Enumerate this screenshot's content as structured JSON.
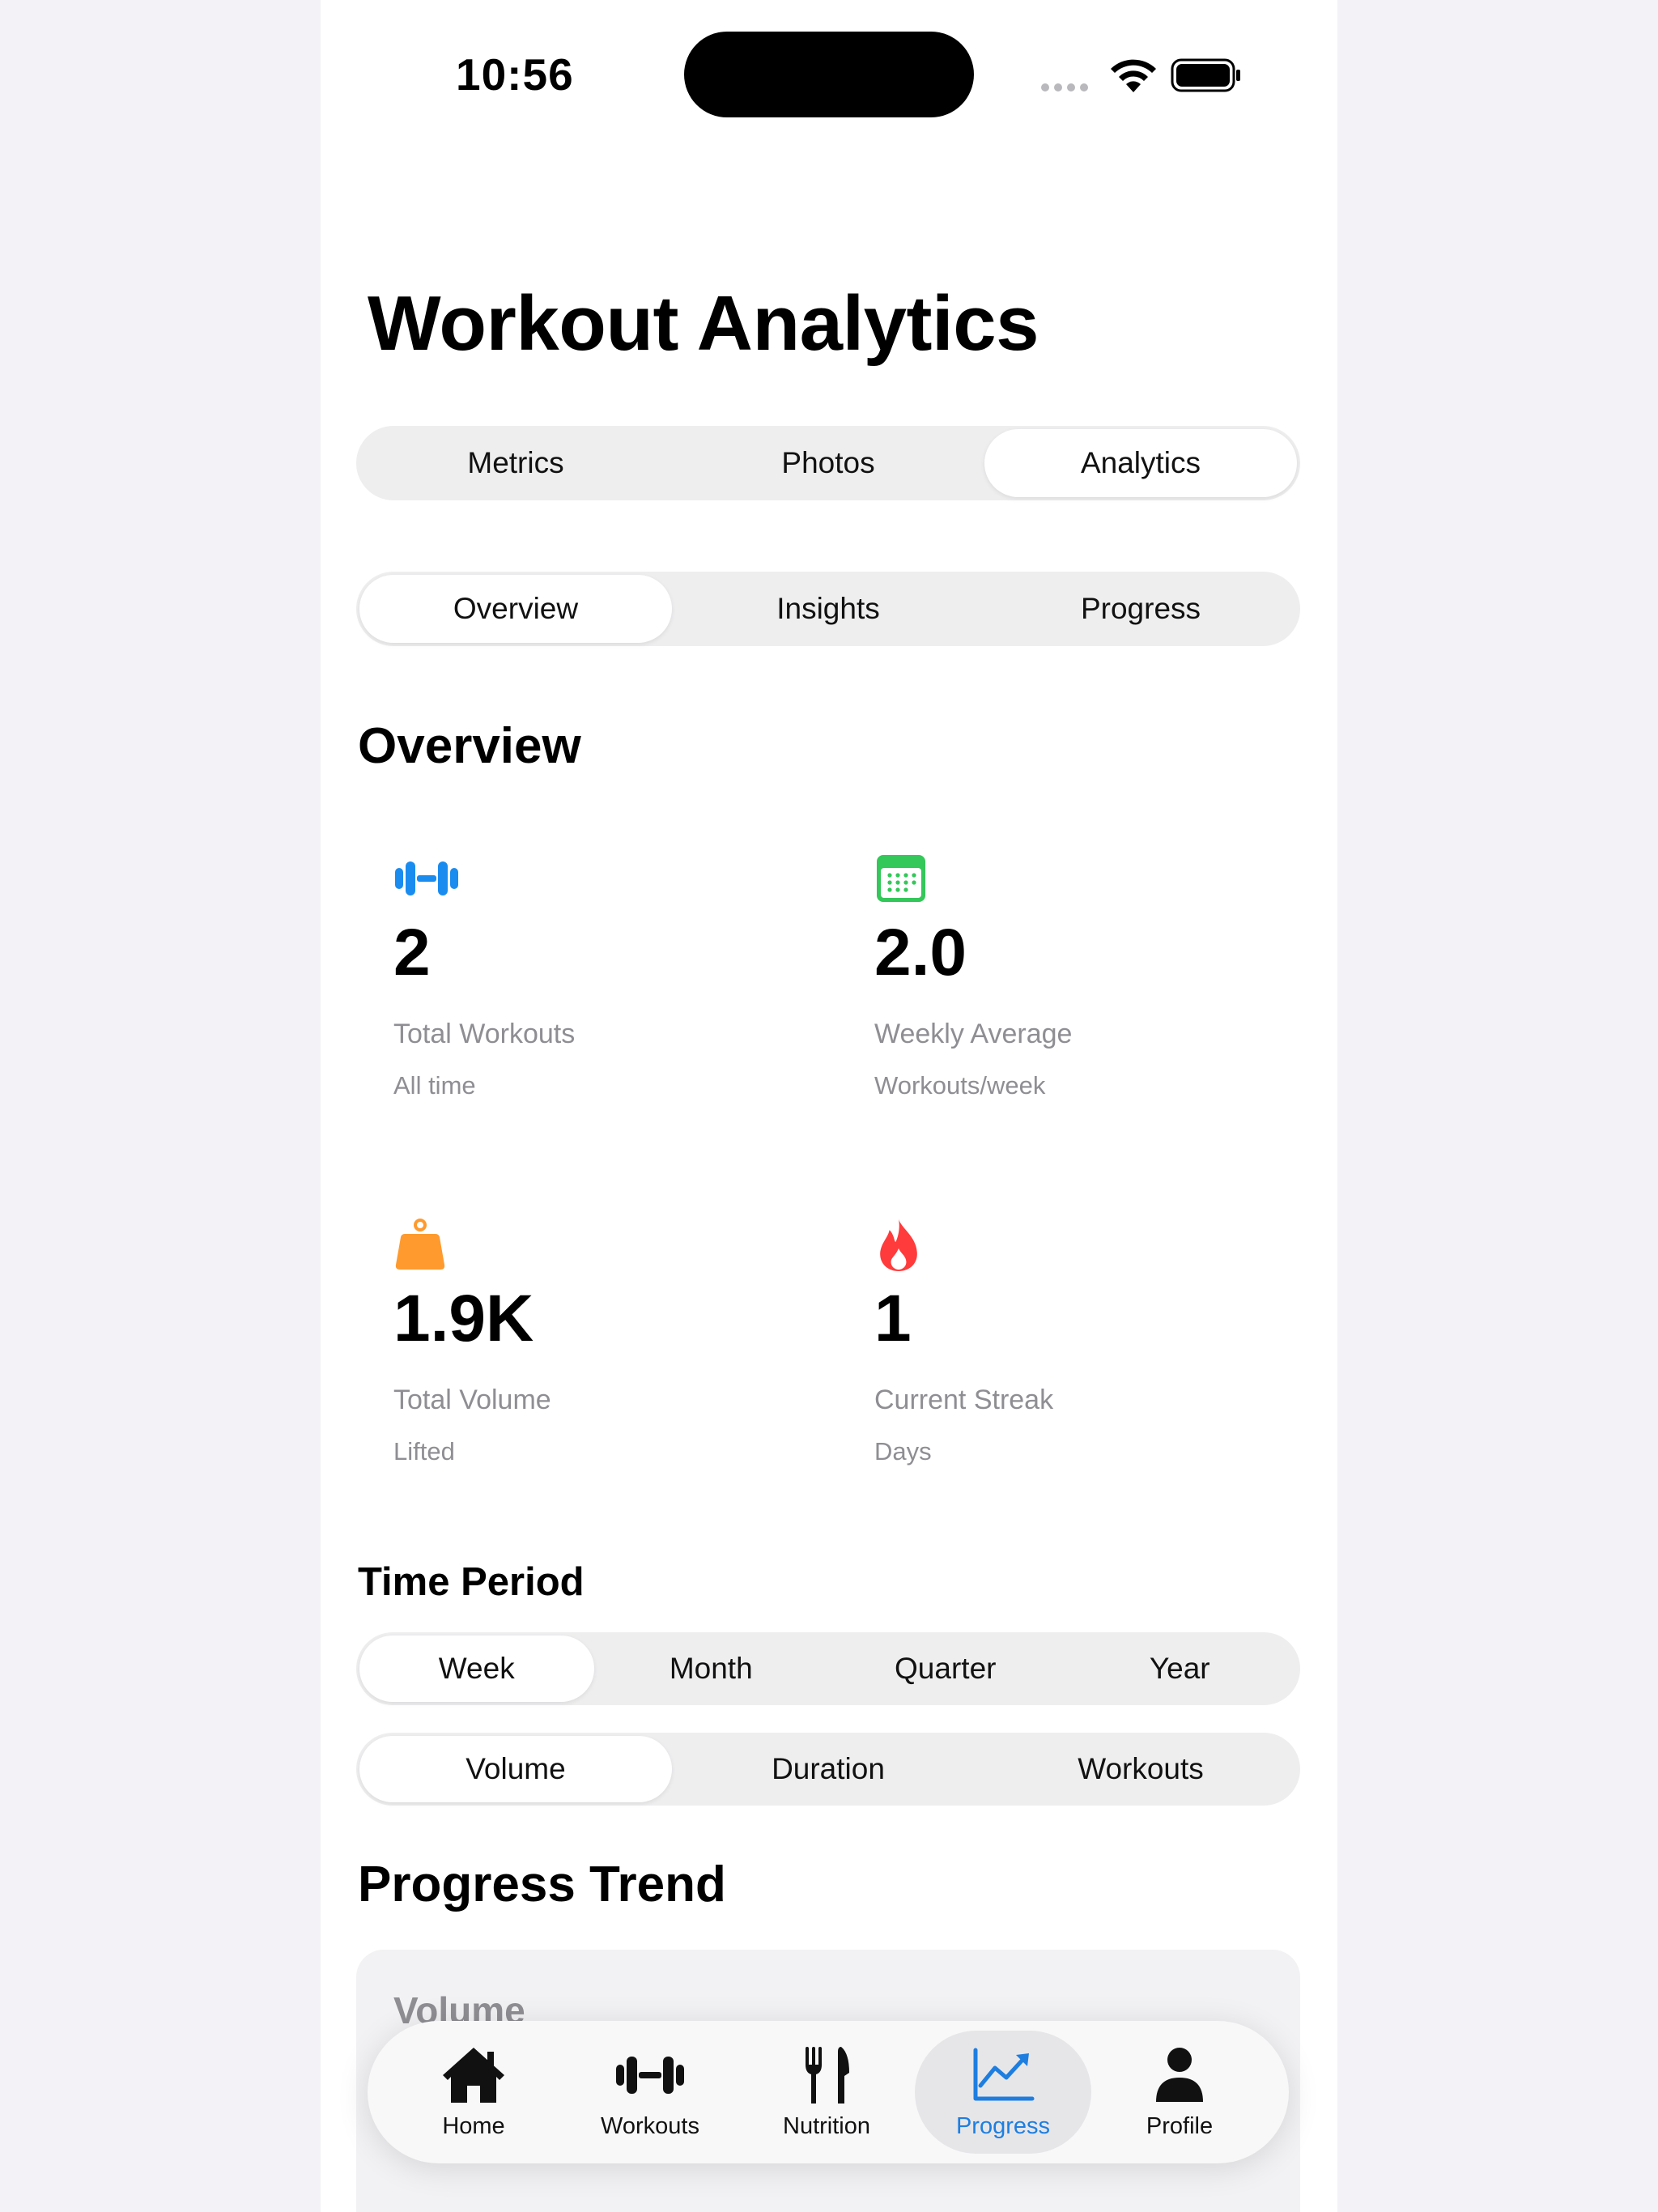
{
  "status_bar": {
    "time": "10:56"
  },
  "header": {
    "title": "Workout Analytics"
  },
  "main_tabs": [
    {
      "label": "Metrics",
      "active": false
    },
    {
      "label": "Photos",
      "active": false
    },
    {
      "label": "Analytics",
      "active": true
    }
  ],
  "sub_tabs": [
    {
      "label": "Overview",
      "active": true
    },
    {
      "label": "Insights",
      "active": false
    },
    {
      "label": "Progress",
      "active": false
    }
  ],
  "overview": {
    "title": "Overview",
    "stats": [
      {
        "icon": "dumbbell-icon",
        "color": "#1a8cf0",
        "value": "2",
        "label": "Total Workouts",
        "sub": "All time"
      },
      {
        "icon": "calendar-icon",
        "color": "#34c759",
        "value": "2.0",
        "label": "Weekly Average",
        "sub": "Workouts/week"
      },
      {
        "icon": "weight-icon",
        "color": "#ff9a2e",
        "value": "1.9K",
        "label": "Total Volume",
        "sub": "Lifted"
      },
      {
        "icon": "flame-icon",
        "color": "#ff3b3b",
        "value": "1",
        "label": "Current Streak",
        "sub": "Days"
      }
    ]
  },
  "time_period": {
    "title": "Time Period",
    "options": [
      {
        "label": "Week",
        "active": true
      },
      {
        "label": "Month",
        "active": false
      },
      {
        "label": "Quarter",
        "active": false
      },
      {
        "label": "Year",
        "active": false
      }
    ]
  },
  "metric_selector": [
    {
      "label": "Volume",
      "active": true
    },
    {
      "label": "Duration",
      "active": false
    },
    {
      "label": "Workouts",
      "active": false
    }
  ],
  "progress_trend": {
    "title": "Progress Trend",
    "card_title": "Volume"
  },
  "tab_bar": [
    {
      "label": "Home",
      "icon": "house-icon",
      "active": false
    },
    {
      "label": "Workouts",
      "icon": "dumbbell-icon",
      "active": false
    },
    {
      "label": "Nutrition",
      "icon": "fork-knife-icon",
      "active": false
    },
    {
      "label": "Progress",
      "icon": "chart-line-icon",
      "active": true
    },
    {
      "label": "Profile",
      "icon": "person-icon",
      "active": false
    }
  ],
  "colors": {
    "accent": "#1e7ee0",
    "secondary_text": "#8e8e93"
  }
}
